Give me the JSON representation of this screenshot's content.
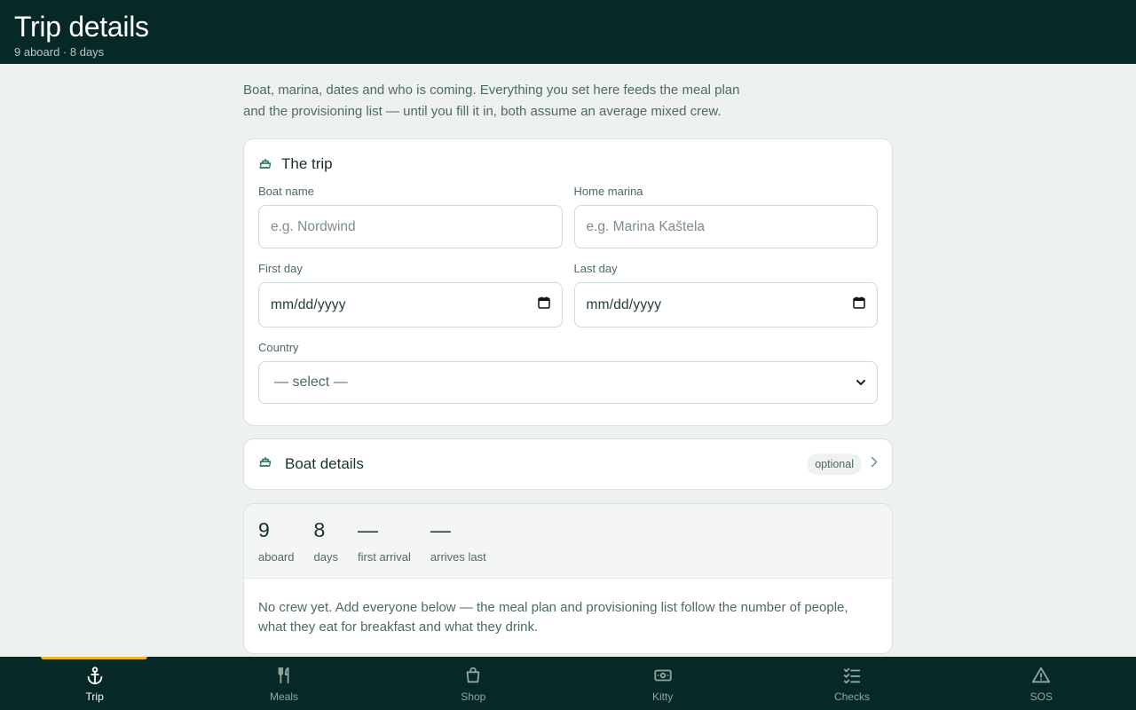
{
  "header": {
    "title": "Trip details",
    "subtitle": "9 aboard · 8 days"
  },
  "intro": "Boat, marina, dates and who is coming. Everything you set here feeds the meal plan and the provisioning list — until you fill it in, both assume an average mixed crew.",
  "trip_card": {
    "title": "The trip",
    "boat_name": {
      "label": "Boat name",
      "placeholder": "e.g. Nordwind",
      "value": ""
    },
    "home_marina": {
      "label": "Home marina",
      "placeholder": "e.g. Marina Kaštela",
      "value": ""
    },
    "first_day": {
      "label": "First day",
      "value": "mm/dd/yyyy"
    },
    "last_day": {
      "label": "Last day",
      "value": "mm/dd/yyyy"
    },
    "country": {
      "label": "Country",
      "selected": "— select —"
    }
  },
  "boat_card": {
    "title": "Boat details",
    "badge": "optional"
  },
  "crew": {
    "stats": [
      {
        "value": "9",
        "caption": "aboard"
      },
      {
        "value": "8",
        "caption": "days"
      },
      {
        "value": "—",
        "caption": "first arrival"
      },
      {
        "value": "—",
        "caption": "arrives last"
      }
    ],
    "note": "No crew yet. Add everyone below — the meal plan and provisioning list follow the number of people, what they eat for breakfast and what they drink."
  },
  "nav": [
    {
      "label": "Trip",
      "icon": "anchor-icon",
      "active": true
    },
    {
      "label": "Meals",
      "icon": "fork-knife-icon",
      "active": false
    },
    {
      "label": "Shop",
      "icon": "shopping-bag-icon",
      "active": false
    },
    {
      "label": "Kitty",
      "icon": "banknote-icon",
      "active": false
    },
    {
      "label": "Checks",
      "icon": "checklist-icon",
      "active": false
    },
    {
      "label": "SOS",
      "icon": "warning-icon",
      "active": false
    }
  ],
  "colors": {
    "header_bg": "#062826",
    "accent": "#e9b52c",
    "page_bg": "#edf2ef",
    "icon_green": "#1f6b57"
  }
}
